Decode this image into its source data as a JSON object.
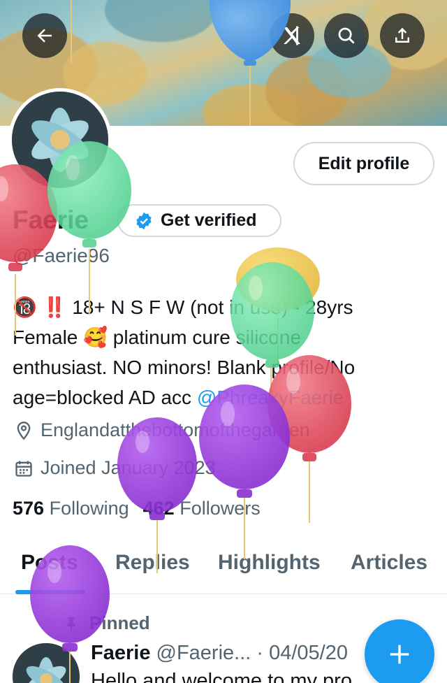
{
  "profile": {
    "name": "Faerie",
    "handle": "@Faerie96",
    "edit_label": "Edit profile",
    "verify_label": "Get verified",
    "bio_line1": "🔞 ‼️ 18+ N S F W (not in use) - 28yrs",
    "bio_line2": "Female 🥰 platinum cure silicone",
    "bio_line3": "enthusiast. NO minors! Blank profile/No",
    "bio_line4_prefix": "age=blocked AD acc ",
    "bio_mention": "@PhreakyFaerie",
    "location": "Englandatthebottomofthegarden",
    "joined": "Joined January 2023",
    "following_count": "576",
    "following_label": "Following",
    "followers_count": "462",
    "followers_label": "Followers"
  },
  "tabs": [
    "Posts",
    "Replies",
    "Highlights",
    "Articles"
  ],
  "post": {
    "pinned_label": "Pinned",
    "author": "Faerie",
    "handle_date": "@Faerie... · 04/05/20",
    "text": "Hello and welcome to my pro"
  },
  "icons": {
    "back": "arrow-left-icon",
    "grok": "grok-icon",
    "search": "search-icon",
    "share": "share-icon",
    "verified": "verified-badge-icon",
    "location": "location-pin-icon",
    "calendar": "calendar-icon",
    "pin": "pin-icon",
    "compose": "plus-icon"
  },
  "colors": {
    "accent": "#1d9bf0",
    "text": "#0f1419",
    "secondary": "#536471"
  }
}
